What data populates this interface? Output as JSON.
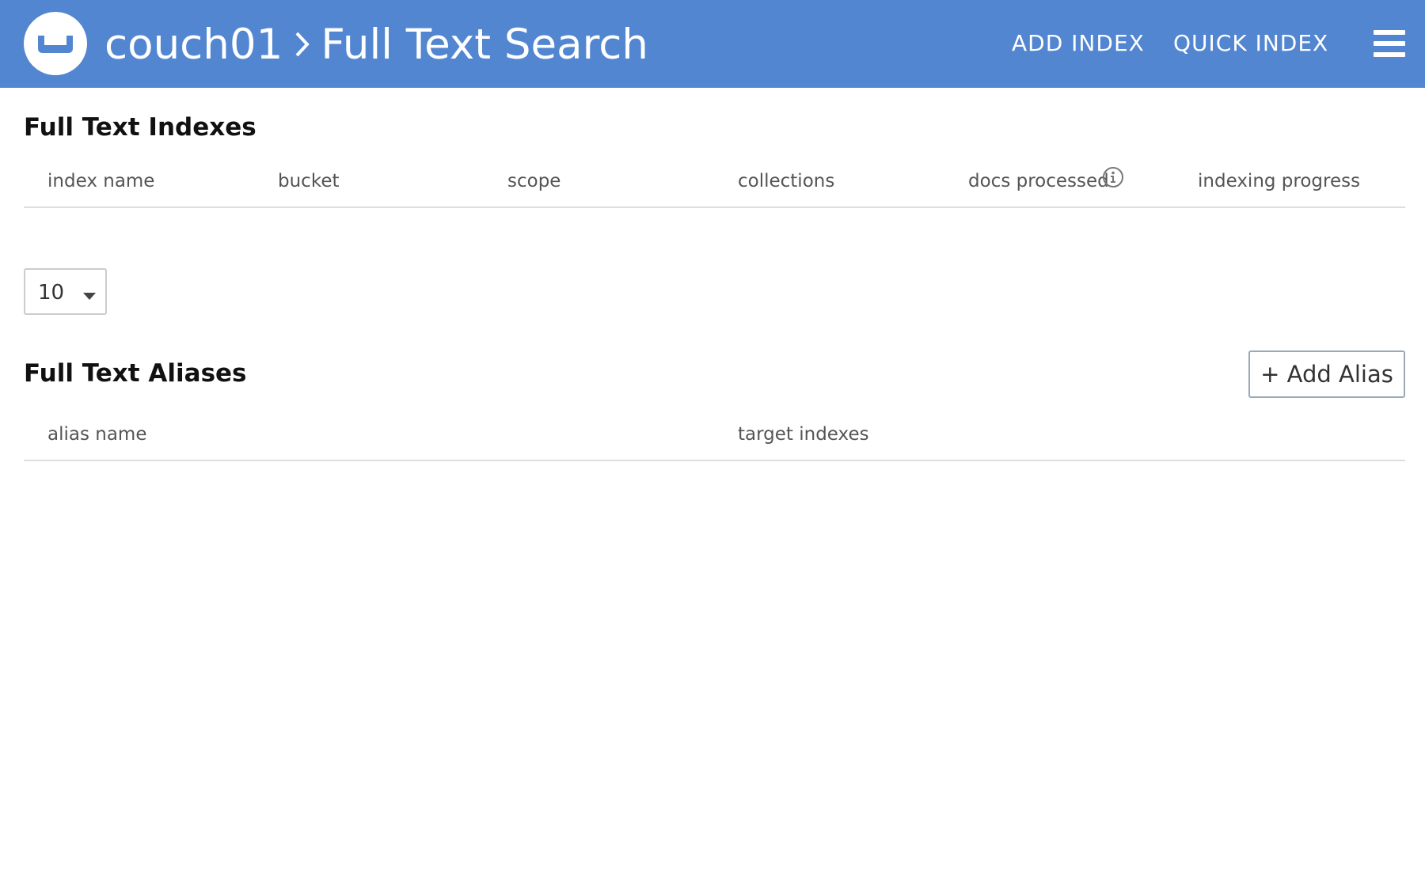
{
  "header": {
    "breadcrumb_root": "couch01",
    "breadcrumb_page": "Full Text Search",
    "add_index_label": "ADD INDEX",
    "quick_index_label": "QUICK INDEX",
    "menu_icon": "hamburger-menu-icon",
    "logo_icon": "couchbase-logo-icon",
    "background_color": "#5286d1"
  },
  "indexes": {
    "title": "Full Text Indexes",
    "columns": [
      "index name",
      "bucket",
      "scope",
      "collections",
      "docs processed",
      "indexing progress"
    ],
    "rows": [],
    "info_icon": "info-icon"
  },
  "pagination": {
    "page_size": "10"
  },
  "aliases": {
    "title": "Full Text Aliases",
    "add_alias_label": "+ Add Alias",
    "columns": [
      "alias name",
      "target indexes"
    ],
    "rows": []
  }
}
